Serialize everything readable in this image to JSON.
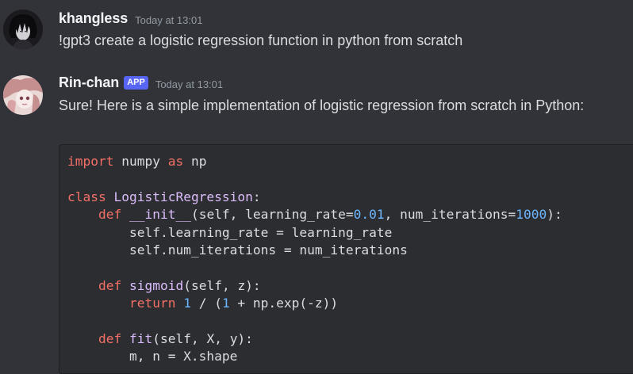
{
  "messages": [
    {
      "username": "khangless",
      "timestamp": "Today at 13:01",
      "text": "!gpt3 create a logistic regression function in python from scratch"
    },
    {
      "username": "Rin-chan",
      "badge": "APP",
      "timestamp": "Today at 13:01",
      "text": "Sure! Here is a simple implementation of logistic regression from scratch in Python:"
    }
  ],
  "code": {
    "language": "python",
    "lines": [
      [
        {
          "t": "import",
          "c": "kw"
        },
        {
          "t": " numpy ",
          "c": "plain"
        },
        {
          "t": "as",
          "c": "kw"
        },
        {
          "t": " np",
          "c": "plain"
        }
      ],
      [],
      [
        {
          "t": "class",
          "c": "kw"
        },
        {
          "t": " ",
          "c": "plain"
        },
        {
          "t": "LogisticRegression",
          "c": "fn"
        },
        {
          "t": ":",
          "c": "plain"
        }
      ],
      [
        {
          "t": "    ",
          "c": "plain"
        },
        {
          "t": "def",
          "c": "kw"
        },
        {
          "t": " ",
          "c": "plain"
        },
        {
          "t": "__init__",
          "c": "fn"
        },
        {
          "t": "(self, learning_rate=",
          "c": "plain"
        },
        {
          "t": "0.01",
          "c": "num"
        },
        {
          "t": ", num_iterations=",
          "c": "plain"
        },
        {
          "t": "1000",
          "c": "num"
        },
        {
          "t": "):",
          "c": "plain"
        }
      ],
      [
        {
          "t": "        self.learning_rate = learning_rate",
          "c": "plain"
        }
      ],
      [
        {
          "t": "        self.num_iterations = num_iterations",
          "c": "plain"
        }
      ],
      [],
      [
        {
          "t": "    ",
          "c": "plain"
        },
        {
          "t": "def",
          "c": "kw"
        },
        {
          "t": " ",
          "c": "plain"
        },
        {
          "t": "sigmoid",
          "c": "fn"
        },
        {
          "t": "(self, z):",
          "c": "plain"
        }
      ],
      [
        {
          "t": "        ",
          "c": "plain"
        },
        {
          "t": "return",
          "c": "kw"
        },
        {
          "t": " ",
          "c": "plain"
        },
        {
          "t": "1",
          "c": "num"
        },
        {
          "t": " / (",
          "c": "plain"
        },
        {
          "t": "1",
          "c": "num"
        },
        {
          "t": " + np.exp(-z))",
          "c": "plain"
        }
      ],
      [],
      [
        {
          "t": "    ",
          "c": "plain"
        },
        {
          "t": "def",
          "c": "kw"
        },
        {
          "t": " ",
          "c": "plain"
        },
        {
          "t": "fit",
          "c": "fn"
        },
        {
          "t": "(self, X, y):",
          "c": "plain"
        }
      ],
      [
        {
          "t": "        m, n = X.shape",
          "c": "plain"
        }
      ]
    ]
  }
}
